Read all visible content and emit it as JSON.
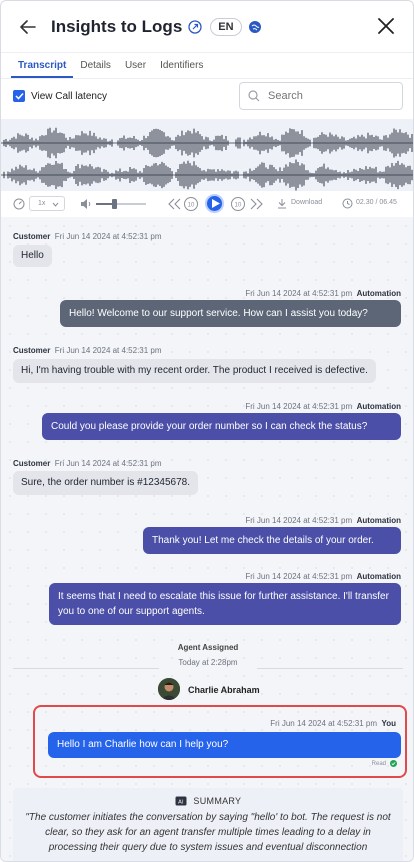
{
  "header": {
    "title": "Insights to Logs",
    "lang": "EN"
  },
  "tabs": [
    {
      "label": "Transcript"
    },
    {
      "label": "Details"
    },
    {
      "label": "User"
    },
    {
      "label": "Identifiers"
    }
  ],
  "controls": {
    "latency_label": "View Call latency",
    "search_placeholder": "Search",
    "speed": "1x",
    "download_label": "Download",
    "time": "02.30 / 06.45"
  },
  "messages": [
    {
      "side": "in",
      "sender": "Customer",
      "time": "Fri Jun 14 2024 at 4:52:31 pm",
      "text": "Hello"
    },
    {
      "side": "out",
      "sender": "Automation",
      "time": "Fri Jun 14 2024 at 4:52:31 pm",
      "text": "Hello! Welcome to our support service. How can I assist you today?"
    },
    {
      "side": "in",
      "sender": "Customer",
      "time": "Fri Jun 14 2024 at 4:52:31 pm",
      "text": "Hi, I'm having trouble with my recent order. The product I received is defective."
    },
    {
      "side": "out",
      "sender": "Automation",
      "time": "Fri Jun 14 2024 at 4:52:31 pm",
      "text": "Could you please provide your order number so I can check the status?"
    },
    {
      "side": "in",
      "sender": "Customer",
      "time": "Fri Jun 14 2024 at 4:52:31 pm",
      "text": "Sure, the order number is #12345678."
    },
    {
      "side": "out",
      "sender": "Automation",
      "time": "Fri Jun 14 2024 at 4:52:31 pm",
      "text": "Thank you! Let me check the details of your order."
    },
    {
      "side": "out",
      "sender": "Automation",
      "time": "Fri Jun 14 2024 at 4:52:31 pm",
      "text": "It seems that I need to escalate this issue for further assistance. I'll transfer you to one of our support agents."
    }
  ],
  "agent": {
    "label": "Agent Assigned",
    "time": "Today at 2:28pm",
    "name": "Charlie Abraham"
  },
  "agent_message": {
    "time": "Fri Jun 14 2024 at 4:52:31 pm",
    "sender": "You",
    "text": "Hello I am Charlie how can I help you?",
    "status": "Read"
  },
  "summary": {
    "title": "SUMMARY",
    "text": "\"The customer initiates the conversation by saying \"hello' to bot. The request is not clear, so they ask for an agent transfer multiple times leading to a delay in processing their query due to system issues and eventual disconnection"
  },
  "colors": {
    "accent": "#2563eb",
    "automation_grey": "#5d6677",
    "automation_indigo": "#4b4fa8",
    "highlight": "#e04a4a"
  }
}
